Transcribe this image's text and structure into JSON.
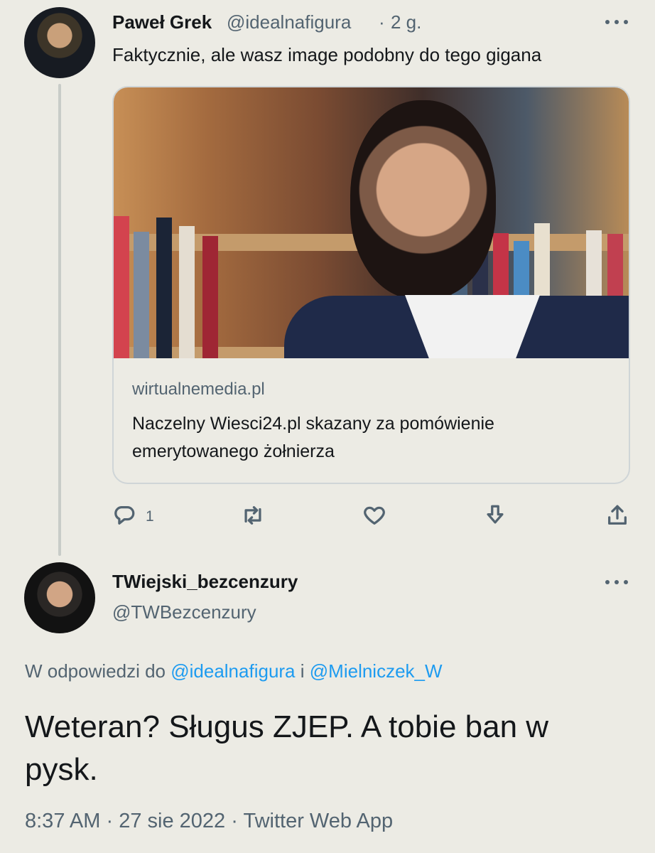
{
  "colors": {
    "background": "#ecebe4",
    "text_primary": "#14171a",
    "text_secondary": "#536471",
    "link": "#1d9bf0"
  },
  "tweet1": {
    "author_name": "Paweł Grek",
    "author_handle": "@idealnafigura",
    "separator": "·",
    "time": "2 g.",
    "text": "Faktycznie, ale wasz image podobny do tego gigana",
    "card": {
      "domain": "wirtualnemedia.pl",
      "title": "Naczelny Wiesci24.pl skazany za pomówienie emerytowanego żołnierza"
    },
    "actions": {
      "reply_icon": "speech-bubble-icon",
      "reply_count": "1",
      "retweet_icon": "retweet-icon",
      "like_icon": "heart-icon",
      "download_icon": "download-icon",
      "share_icon": "share-icon"
    }
  },
  "tweet2": {
    "author_name": "TWiejski_bezcenzury",
    "author_handle": "@TWBezcenzury",
    "reply_prefix": "W odpowiedzi do",
    "reply_to_1": "@idealnafigura",
    "reply_conjunction": "i",
    "reply_to_2": "@Mielniczek_W",
    "text": "Weteran? Sługus ZJEP. A tobie ban w pysk.",
    "time": "8:37 AM",
    "date": "27 sie 2022",
    "source": "Twitter Web App",
    "meta_separator": "·"
  }
}
